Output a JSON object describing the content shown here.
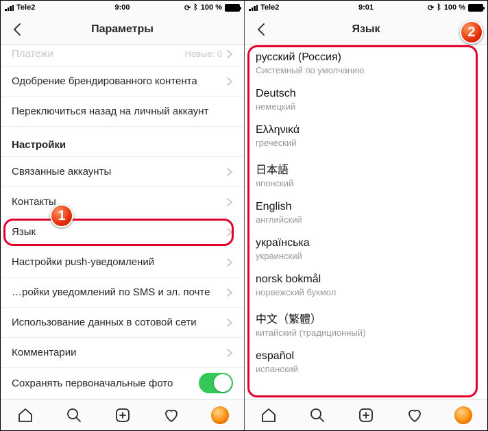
{
  "left": {
    "status": {
      "carrier": "Tele2",
      "time": "9:00",
      "lock": "⊙",
      "bt": "✱",
      "battery_pct": "100 %"
    },
    "title": "Параметры",
    "rows": {
      "payments": {
        "label": "Платежи",
        "hint": "Новые: 0"
      },
      "branded": {
        "label": "Одобрение брендированного контента"
      },
      "switch_personal": {
        "label": "Переключиться назад на личный аккаунт"
      },
      "section": "Настройки",
      "linked": {
        "label": "Связанные аккаунты"
      },
      "contacts": {
        "label": "Контакты"
      },
      "language": {
        "label": "Язык"
      },
      "push": {
        "label": "Настройки push-уведомлений"
      },
      "sms_email": {
        "label": "…ройки уведомлений по SMS и эл. почте"
      },
      "cellular": {
        "label": "Использование данных в сотовой сети"
      },
      "comments": {
        "label": "Комментарии"
      },
      "save_original": {
        "label": "Сохранять первоначальные фото"
      }
    },
    "badge": "1"
  },
  "right": {
    "status": {
      "carrier": "Tele2",
      "time": "9:01",
      "lock": "⊙",
      "bt": "✱",
      "battery_pct": "100 %"
    },
    "title": "Язык",
    "langs": [
      {
        "name": "русский (Россия)",
        "sub": "Системный по умолчанию"
      },
      {
        "name": "Deutsch",
        "sub": "немецкий"
      },
      {
        "name": "Ελληνικά",
        "sub": "греческий"
      },
      {
        "name": "日本語",
        "sub": "японский"
      },
      {
        "name": "English",
        "sub": "английский"
      },
      {
        "name": "українська",
        "sub": "украинский"
      },
      {
        "name": "norsk bokmål",
        "sub": "норвежский букмол"
      },
      {
        "name": "中文（繁體）",
        "sub": "китайский (традиционный)"
      },
      {
        "name": "español",
        "sub": "испанский"
      }
    ],
    "badge": "2"
  }
}
